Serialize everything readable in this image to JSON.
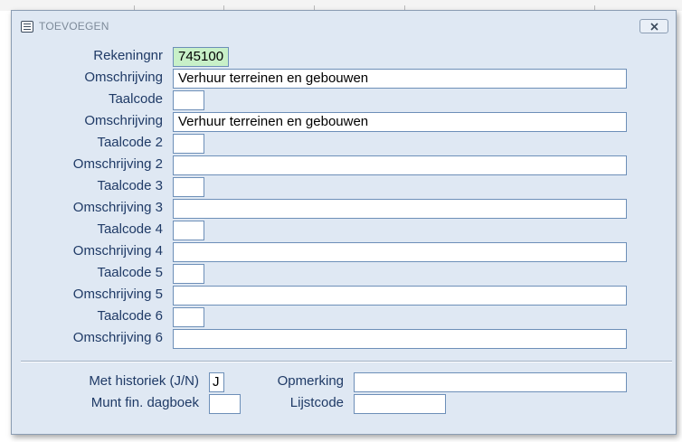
{
  "window": {
    "title": "TOEVOEGEN",
    "icon": "form-icon",
    "close_icon": "close-icon"
  },
  "form": {
    "rekeningnr": {
      "label": "Rekeningnr",
      "value": "745100"
    },
    "omschrijving1": {
      "label": "Omschrijving",
      "value": "Verhuur terreinen en gebouwen"
    },
    "taalcode1": {
      "label": "Taalcode",
      "value": ""
    },
    "omschrijving1b": {
      "label": "Omschrijving",
      "value": "Verhuur terreinen en gebouwen"
    },
    "taalcode2": {
      "label": "Taalcode 2",
      "value": ""
    },
    "omschrijving2": {
      "label": "Omschrijving 2",
      "value": ""
    },
    "taalcode3": {
      "label": "Taalcode 3",
      "value": ""
    },
    "omschrijving3": {
      "label": "Omschrijving 3",
      "value": ""
    },
    "taalcode4": {
      "label": "Taalcode 4",
      "value": ""
    },
    "omschrijving4": {
      "label": "Omschrijving 4",
      "value": ""
    },
    "taalcode5": {
      "label": "Taalcode 5",
      "value": ""
    },
    "omschrijving5": {
      "label": "Omschrijving 5",
      "value": ""
    },
    "taalcode6": {
      "label": "Taalcode 6",
      "value": ""
    },
    "omschrijving6": {
      "label": "Omschrijving 6",
      "value": ""
    }
  },
  "extra": {
    "met_historiek": {
      "label": "Met historiek (J/N)",
      "value": "J"
    },
    "opmerking": {
      "label": "Opmerking",
      "value": ""
    },
    "munt_fin_dagboek": {
      "label": "Munt fin. dagboek",
      "value": ""
    },
    "lijstcode": {
      "label": "Lijstcode",
      "value": ""
    }
  },
  "colors": {
    "window_bg": "#dfe8f3",
    "label_text": "#1f3a66",
    "field_border": "#6d8fb8",
    "highlight_field": "#c8f0c8"
  }
}
